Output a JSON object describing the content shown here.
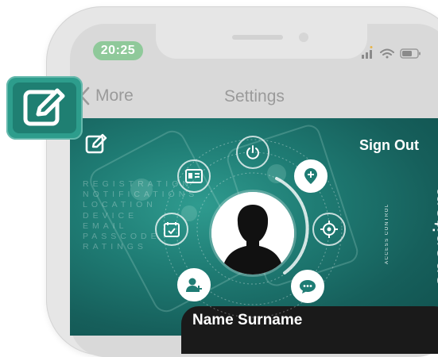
{
  "status_bar": {
    "time": "20:25",
    "icons": [
      "signal-icon",
      "wifi-icon",
      "battery-icon"
    ]
  },
  "nav": {
    "back_label": "More",
    "title": "Settings"
  },
  "app": {
    "sign_out": "Sign Out",
    "menu_labels": [
      "REGISTRATION",
      "NOTIFICATIONS",
      "LOCATION",
      "DEVICE",
      "EMAIL",
      "PASSCODE",
      "RATINGS"
    ],
    "user_name": "Name Surname",
    "brand": {
      "name": "openitem",
      "tagline": "ACCESS CONTROL"
    },
    "orbit_buttons": [
      "power-icon",
      "id-card-icon",
      "add-location-icon",
      "calendar-check-icon",
      "crosshair-icon",
      "add-user-icon",
      "chat-icon"
    ]
  },
  "colors": {
    "accent": "#2d9d8c",
    "time_pill": "#8fc99a",
    "background_teal": "#1f7c74"
  }
}
